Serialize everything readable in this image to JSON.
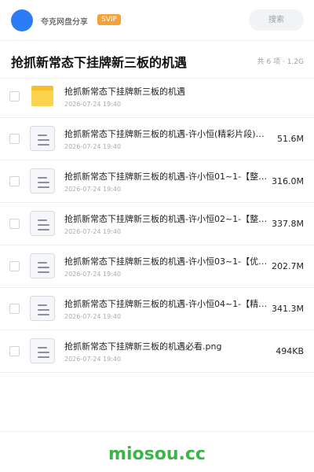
{
  "header": {
    "app_name": "夸克网盘分享",
    "badge": "SVIP",
    "search_label": "搜索",
    "accent": "#2b7cf6",
    "badge_color": "#f2a13b"
  },
  "share": {
    "title": "抢抓新常态下挂牌新三板的机遇",
    "count": "共 6 项",
    "total_size": "1.2G"
  },
  "files": [
    {
      "type": "folder",
      "icon": "folder-icon",
      "name": "抢抓新常态下挂牌新三板的机遇",
      "date": "2026-07-24 19:40",
      "size": ""
    },
    {
      "type": "file",
      "icon": "document-icon",
      "name": "抢抓新常态下挂牌新三板的机遇-许小恒(精彩片段)~…",
      "date": "2026-07-24 19:40",
      "size": "51.6M"
    },
    {
      "type": "file",
      "icon": "document-icon",
      "name": "抢抓新常态下挂牌新三板的机遇-许小恒01~1-【整…",
      "date": "2026-07-24 19:40",
      "size": "316.0M"
    },
    {
      "type": "file",
      "icon": "document-icon",
      "name": "抢抓新常态下挂牌新三板的机遇-许小恒02~1-【整…",
      "date": "2026-07-24 19:40",
      "size": "337.8M"
    },
    {
      "type": "file",
      "icon": "document-icon",
      "name": "抢抓新常态下挂牌新三板的机遇-许小恒03~1-【优…",
      "date": "2026-07-24 19:40",
      "size": "202.7M"
    },
    {
      "type": "file",
      "icon": "document-icon",
      "name": "抢抓新常态下挂牌新三板的机遇-许小恒04~1-【精…",
      "date": "2026-07-24 19:40",
      "size": "341.3M"
    },
    {
      "type": "file",
      "icon": "document-icon",
      "name": "抢抓新常态下挂牌新三板的机遇必看.png",
      "date": "2026-07-24 19:40",
      "size": "494KB"
    }
  ],
  "footer": {
    "watermark": "miosou.cc",
    "watermark_color": "#3bb54a"
  }
}
